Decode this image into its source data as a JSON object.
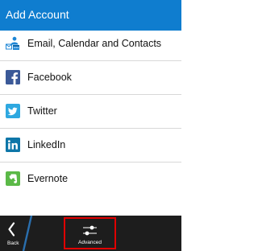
{
  "header": {
    "title": "Add Account"
  },
  "accounts": [
    {
      "label": "Email, Calendar and Contacts",
      "icon": "email-calendar-contacts-icon",
      "color": "#1d86d6"
    },
    {
      "label": "Facebook",
      "icon": "facebook-icon",
      "color": "#3b5998"
    },
    {
      "label": "Twitter",
      "icon": "twitter-icon",
      "color": "#2ea8e0"
    },
    {
      "label": "LinkedIn",
      "icon": "linkedin-icon",
      "color": "#0e76a8"
    },
    {
      "label": "Evernote",
      "icon": "evernote-icon",
      "color": "#5bb947"
    }
  ],
  "action_bar": {
    "back_label": "Back",
    "advanced_label": "Advanced",
    "back_icon": "back-chevron-icon",
    "advanced_icon": "sliders-icon",
    "highlight_color": "#e00000"
  },
  "colors": {
    "title_bar": "#0f7dcf",
    "action_bar": "#1d1d1d"
  }
}
